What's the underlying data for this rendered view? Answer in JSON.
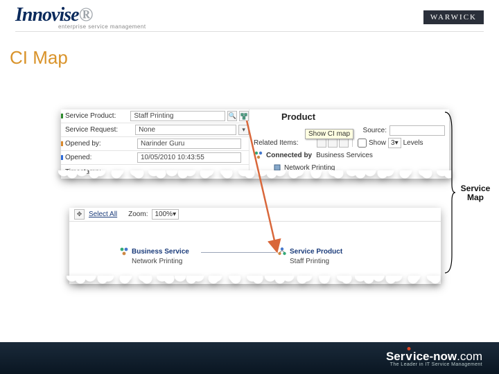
{
  "brand": {
    "logo": "Innovise",
    "tagline": "enterprise service management",
    "partner": "WARWICK"
  },
  "page_title": "CI Map",
  "panel1": {
    "fields": {
      "service_product": {
        "label": "Service Product:",
        "value": "Staff Printing"
      },
      "service_request": {
        "label": "Service Request:",
        "value": "None"
      },
      "opened_by": {
        "label": "Opened by:",
        "value": "Narinder Guru"
      },
      "opened": {
        "label": "Opened:",
        "value": "10/05/2010 10:43:55"
      },
      "timestamp": {
        "label": "Timestamp:"
      }
    },
    "tooltip": "Show CI map",
    "right": {
      "title": "Product",
      "source_label": "Source:",
      "related_label": "Related Items:",
      "show_label": "Show",
      "levels_value": "3",
      "levels_suffix": "Levels",
      "connected_label": "Connected by",
      "connected_value": "Business Services",
      "subnode": "Network Printing"
    }
  },
  "panel2": {
    "toolbar": {
      "select_all": "Select All",
      "zoom_label": "Zoom:",
      "zoom_value": "100%"
    },
    "nodes": {
      "left": {
        "title": "Business Service",
        "sub": "Network Printing"
      },
      "right": {
        "title": "Service Product",
        "sub": "Staff Printing"
      }
    }
  },
  "callout": {
    "line1": "Service",
    "line2": "Map"
  },
  "footer": {
    "logo_a": "Ser",
    "logo_v": "v",
    "logo_b": "ice-now",
    "logo_c": ".com",
    "tag": "The Leader in IT Service Management"
  }
}
